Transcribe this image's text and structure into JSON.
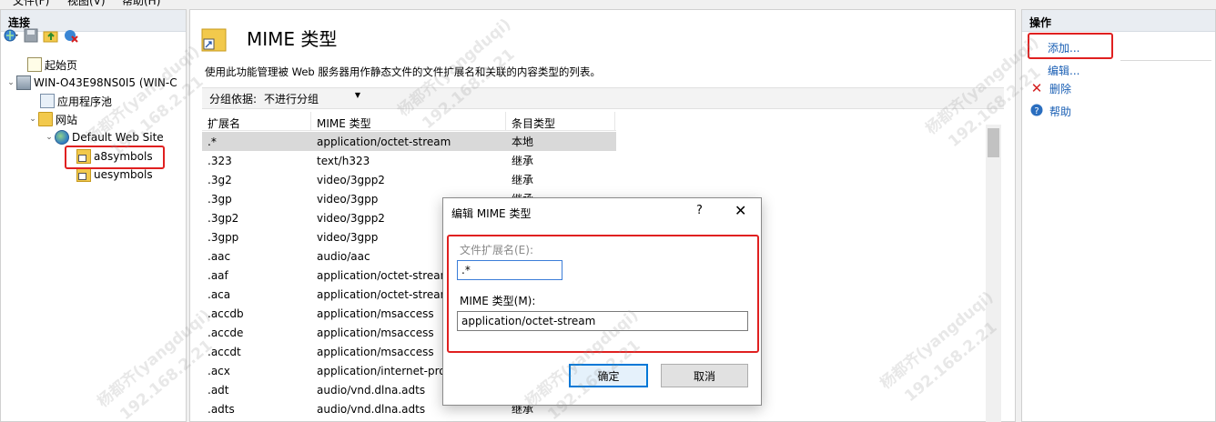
{
  "menubar": {
    "items": [
      "文件(F)",
      "视图(V)",
      "帮助(H)"
    ]
  },
  "connections": {
    "title": "连接",
    "toolbar_icons": [
      "connect-icon",
      "save-icon",
      "up-folder-icon",
      "delete-connection-icon"
    ],
    "tree": [
      {
        "label": "起始页",
        "icon": "start-page-icon"
      },
      {
        "label": "WIN-O43E98NS0I5 (WIN-C",
        "icon": "server-icon"
      },
      {
        "label": "应用程序池",
        "icon": "app-pool-icon"
      },
      {
        "label": "网站",
        "icon": "sites-folder-icon"
      },
      {
        "label": "Default Web Site",
        "icon": "globe-icon"
      },
      {
        "label": "a8symbols",
        "icon": "web-folder-icon"
      },
      {
        "label": "uesymbols",
        "icon": "web-folder-icon"
      }
    ]
  },
  "main": {
    "title": "MIME 类型",
    "description": "使用此功能管理被 Web 服务器用作静态文件的文件扩展名和关联的内容类型的列表。",
    "group_by_label": "分组依据:",
    "group_by_value": "不进行分组",
    "columns": [
      "扩展名",
      "MIME 类型",
      "条目类型"
    ],
    "rows": [
      [
        ".*",
        "application/octet-stream",
        "本地"
      ],
      [
        ".323",
        "text/h323",
        "继承"
      ],
      [
        ".3g2",
        "video/3gpp2",
        "继承"
      ],
      [
        ".3gp",
        "video/3gpp",
        "继承"
      ],
      [
        ".3gp2",
        "video/3gpp2",
        ""
      ],
      [
        ".3gpp",
        "video/3gpp",
        ""
      ],
      [
        ".aac",
        "audio/aac",
        ""
      ],
      [
        ".aaf",
        "application/octet-stream",
        ""
      ],
      [
        ".aca",
        "application/octet-stream",
        ""
      ],
      [
        ".accdb",
        "application/msaccess",
        ""
      ],
      [
        ".accde",
        "application/msaccess",
        ""
      ],
      [
        ".accdt",
        "application/msaccess",
        ""
      ],
      [
        ".acx",
        "application/internet-pro",
        ""
      ],
      [
        ".adt",
        "audio/vnd.dlna.adts",
        ""
      ],
      [
        ".adts",
        "audio/vnd.dlna.adts",
        "继承"
      ]
    ]
  },
  "actions": {
    "title": "操作",
    "items": [
      {
        "label": "添加...",
        "icon": ""
      },
      {
        "label": "编辑...",
        "icon": ""
      },
      {
        "label": "删除",
        "icon": "delete-icon"
      },
      {
        "label": "帮助",
        "icon": "help-icon"
      }
    ]
  },
  "dialog": {
    "title": "编辑 MIME 类型",
    "help": "?",
    "close": "✕",
    "ext_label": "文件扩展名(E):",
    "ext_value": ".*",
    "mime_label": "MIME 类型(M):",
    "mime_value": "application/octet-stream",
    "ok_label": "确定",
    "cancel_label": "取消"
  },
  "watermark": {
    "name": "杨都齐(yangduqi)",
    "ip": "192.168.2.21"
  },
  "colors": {
    "highlight_red": "#e02020",
    "link_blue": "#1a5fb4",
    "selected_row": "#d9d9d9"
  }
}
